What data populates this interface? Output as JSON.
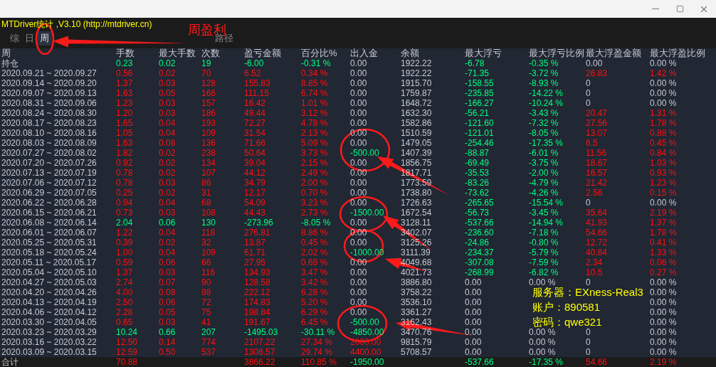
{
  "window": {
    "title": "MTDriver统计 ,V3.10 (http://mtdriver.cn)"
  },
  "tabs": [
    {
      "label": "综",
      "selected": false
    },
    {
      "label": "日",
      "selected": false
    },
    {
      "label": "周",
      "selected": true
    }
  ],
  "path_label": "路径",
  "annotation_label": "周盈利",
  "table": {
    "columns": [
      "周",
      "手数",
      "最大手数",
      "次数",
      "盈亏金额",
      "百分比%",
      "出入金",
      "余额",
      "最大浮亏",
      "最大浮亏比例",
      "最大浮盈金额",
      "最大浮盈比例"
    ],
    "rows": [
      {
        "kind": "open",
        "cells": [
          {
            "text": "持仓"
          },
          {
            "text": "0.23",
            "color": "#00ff80"
          },
          {
            "text": "0.02",
            "color": "#00ff80"
          },
          {
            "text": "19",
            "color": "#00ff80"
          },
          {
            "text": "-6.00",
            "color": "#00ff80"
          },
          {
            "text": "-0.31 %",
            "color": "#00ff80"
          },
          {
            "text": "0.00",
            "color": "#c6cad2"
          },
          {
            "text": "1922.22",
            "color": "#c6cad2"
          },
          {
            "text": "-6.78",
            "color": "#00ff80"
          },
          {
            "text": "-0.35 %",
            "color": "#00ff80"
          },
          {
            "text": "0.00",
            "color": "#c6cad2"
          },
          {
            "text": "0.00 %",
            "color": "#c6cad2"
          }
        ]
      },
      {
        "kind": "week",
        "cells": [
          {
            "text": "2020.09.21 ~ 2020.09.27"
          },
          {
            "text": "0.56",
            "color": "#ff1010"
          },
          {
            "text": "0.02",
            "color": "#ff1010"
          },
          {
            "text": "70",
            "color": "#ff1010"
          },
          {
            "text": "6.52",
            "color": "#ff1010"
          },
          {
            "text": "0.34 %",
            "color": "#ff1010"
          },
          {
            "text": "0.00",
            "color": "#c6cad2"
          },
          {
            "text": "1922.22",
            "color": "#c6cad2"
          },
          {
            "text": "-71.35",
            "color": "#00ff80"
          },
          {
            "text": "-3.72 %",
            "color": "#00ff80"
          },
          {
            "text": "26.83",
            "color": "#ff1010"
          },
          {
            "text": "1.42 %",
            "color": "#ff1010"
          }
        ]
      },
      {
        "kind": "week",
        "cells": [
          {
            "text": "2020.09.14 ~ 2020.09.20"
          },
          {
            "text": "1.37",
            "color": "#ff1010"
          },
          {
            "text": "0.03",
            "color": "#ff1010"
          },
          {
            "text": "128",
            "color": "#ff1010"
          },
          {
            "text": "155.83",
            "color": "#ff1010"
          },
          {
            "text": "8.85 %",
            "color": "#ff1010"
          },
          {
            "text": "0.00",
            "color": "#c6cad2"
          },
          {
            "text": "1915.70",
            "color": "#c6cad2"
          },
          {
            "text": "-158.55",
            "color": "#00ff80"
          },
          {
            "text": "-8.93 %",
            "color": "#00ff80"
          },
          {
            "text": "0",
            "color": "#c6cad2"
          },
          {
            "text": "0.00 %",
            "color": "#c6cad2"
          }
        ]
      },
      {
        "kind": "week",
        "cells": [
          {
            "text": "2020.09.07 ~ 2020.09.13"
          },
          {
            "text": "1.63",
            "color": "#ff1010"
          },
          {
            "text": "0.05",
            "color": "#ff1010"
          },
          {
            "text": "166",
            "color": "#ff1010"
          },
          {
            "text": "111.15",
            "color": "#ff1010"
          },
          {
            "text": "6.74 %",
            "color": "#ff1010"
          },
          {
            "text": "0.00",
            "color": "#c6cad2"
          },
          {
            "text": "1759.87",
            "color": "#c6cad2"
          },
          {
            "text": "-235.85",
            "color": "#00ff80"
          },
          {
            "text": "-14.22 %",
            "color": "#00ff80"
          },
          {
            "text": "0",
            "color": "#c6cad2"
          },
          {
            "text": "0.00 %",
            "color": "#c6cad2"
          }
        ]
      },
      {
        "kind": "week",
        "cells": [
          {
            "text": "2020.08.31 ~ 2020.09.06"
          },
          {
            "text": "1.23",
            "color": "#ff1010"
          },
          {
            "text": "0.03",
            "color": "#ff1010"
          },
          {
            "text": "157",
            "color": "#ff1010"
          },
          {
            "text": "16.42",
            "color": "#ff1010"
          },
          {
            "text": "1.01 %",
            "color": "#ff1010"
          },
          {
            "text": "0.00",
            "color": "#c6cad2"
          },
          {
            "text": "1648.72",
            "color": "#c6cad2"
          },
          {
            "text": "-166.27",
            "color": "#00ff80"
          },
          {
            "text": "-10.24 %",
            "color": "#00ff80"
          },
          {
            "text": "0",
            "color": "#c6cad2"
          },
          {
            "text": "0.00 %",
            "color": "#c6cad2"
          }
        ]
      },
      {
        "kind": "week",
        "cells": [
          {
            "text": "2020.08.24 ~ 2020.08.30"
          },
          {
            "text": "1.20",
            "color": "#ff1010"
          },
          {
            "text": "0.03",
            "color": "#ff1010"
          },
          {
            "text": "186",
            "color": "#ff1010"
          },
          {
            "text": "49.44",
            "color": "#ff1010"
          },
          {
            "text": "3.12 %",
            "color": "#ff1010"
          },
          {
            "text": "0.00",
            "color": "#c6cad2"
          },
          {
            "text": "1632.30",
            "color": "#c6cad2"
          },
          {
            "text": "-56.21",
            "color": "#00ff80"
          },
          {
            "text": "-3.43 %",
            "color": "#00ff80"
          },
          {
            "text": "20.47",
            "color": "#ff1010"
          },
          {
            "text": "1.31 %",
            "color": "#ff1010"
          }
        ]
      },
      {
        "kind": "week",
        "cells": [
          {
            "text": "2020.08.17 ~ 2020.08.23"
          },
          {
            "text": "1.65",
            "color": "#ff1010"
          },
          {
            "text": "0.04",
            "color": "#ff1010"
          },
          {
            "text": "193",
            "color": "#ff1010"
          },
          {
            "text": "72.27",
            "color": "#ff1010"
          },
          {
            "text": "4.78 %",
            "color": "#ff1010"
          },
          {
            "text": "0.00",
            "color": "#c6cad2"
          },
          {
            "text": "1582.86",
            "color": "#c6cad2"
          },
          {
            "text": "-121.60",
            "color": "#00ff80"
          },
          {
            "text": "-7.32 %",
            "color": "#00ff80"
          },
          {
            "text": "27.56",
            "color": "#ff1010"
          },
          {
            "text": "1.78 %",
            "color": "#ff1010"
          }
        ]
      },
      {
        "kind": "week",
        "cells": [
          {
            "text": "2020.08.10 ~ 2020.08.16"
          },
          {
            "text": "1.05",
            "color": "#ff1010"
          },
          {
            "text": "0.04",
            "color": "#ff1010"
          },
          {
            "text": "109",
            "color": "#ff1010"
          },
          {
            "text": "31.54",
            "color": "#ff1010"
          },
          {
            "text": "2.13 %",
            "color": "#ff1010"
          },
          {
            "text": "0.00",
            "color": "#c6cad2"
          },
          {
            "text": "1510.59",
            "color": "#c6cad2"
          },
          {
            "text": "-121.01",
            "color": "#00ff80"
          },
          {
            "text": "-8.05 %",
            "color": "#00ff80"
          },
          {
            "text": "13.07",
            "color": "#ff1010"
          },
          {
            "text": "0.88 %",
            "color": "#ff1010"
          }
        ]
      },
      {
        "kind": "week",
        "cells": [
          {
            "text": "2020.08.03 ~ 2020.08.09"
          },
          {
            "text": "1.63",
            "color": "#ff1010"
          },
          {
            "text": "0.08",
            "color": "#ff1010"
          },
          {
            "text": "136",
            "color": "#ff1010"
          },
          {
            "text": "71.66",
            "color": "#ff1010"
          },
          {
            "text": "5.09 %",
            "color": "#ff1010"
          },
          {
            "text": "0.00",
            "color": "#c6cad2"
          },
          {
            "text": "1479.05",
            "color": "#c6cad2"
          },
          {
            "text": "-254.46",
            "color": "#00ff80"
          },
          {
            "text": "-17.35 %",
            "color": "#00ff80"
          },
          {
            "text": "6.5",
            "color": "#ff1010"
          },
          {
            "text": "0.45 %",
            "color": "#ff1010"
          }
        ]
      },
      {
        "kind": "week",
        "cells": [
          {
            "text": "2020.07.27 ~ 2020.08.02"
          },
          {
            "text": "1.82",
            "color": "#ff1010"
          },
          {
            "text": "0.02",
            "color": "#ff1010"
          },
          {
            "text": "238",
            "color": "#ff1010"
          },
          {
            "text": "50.64",
            "color": "#ff1010"
          },
          {
            "text": "3.73 %",
            "color": "#ff1010"
          },
          {
            "text": "-500.00",
            "color": "#00ff80"
          },
          {
            "text": "1407.39",
            "color": "#c6cad2"
          },
          {
            "text": "-88.87",
            "color": "#00ff80"
          },
          {
            "text": "-6.01 %",
            "color": "#00ff80"
          },
          {
            "text": "11.56",
            "color": "#ff1010"
          },
          {
            "text": "0.84 %",
            "color": "#ff1010"
          }
        ]
      },
      {
        "kind": "week",
        "cells": [
          {
            "text": "2020.07.20 ~ 2020.07.26"
          },
          {
            "text": "0.92",
            "color": "#ff1010"
          },
          {
            "text": "0.02",
            "color": "#ff1010"
          },
          {
            "text": "134",
            "color": "#ff1010"
          },
          {
            "text": "39.04",
            "color": "#ff1010"
          },
          {
            "text": "2.15 %",
            "color": "#ff1010"
          },
          {
            "text": "0.00",
            "color": "#c6cad2"
          },
          {
            "text": "1856.75",
            "color": "#c6cad2"
          },
          {
            "text": "-69.49",
            "color": "#00ff80"
          },
          {
            "text": "-3.75 %",
            "color": "#00ff80"
          },
          {
            "text": "18.67",
            "color": "#ff1010"
          },
          {
            "text": "1.03 %",
            "color": "#ff1010"
          }
        ]
      },
      {
        "kind": "week",
        "cells": [
          {
            "text": "2020.07.13 ~ 2020.07.19"
          },
          {
            "text": "0.78",
            "color": "#ff1010"
          },
          {
            "text": "0.02",
            "color": "#ff1010"
          },
          {
            "text": "107",
            "color": "#ff1010"
          },
          {
            "text": "44.12",
            "color": "#ff1010"
          },
          {
            "text": "2.49 %",
            "color": "#ff1010"
          },
          {
            "text": "0.00",
            "color": "#c6cad2"
          },
          {
            "text": "1817.71",
            "color": "#c6cad2"
          },
          {
            "text": "-35.53",
            "color": "#00ff80"
          },
          {
            "text": "-2.00 %",
            "color": "#00ff80"
          },
          {
            "text": "16.57",
            "color": "#ff1010"
          },
          {
            "text": "0.93 %",
            "color": "#ff1010"
          }
        ]
      },
      {
        "kind": "week",
        "cells": [
          {
            "text": "2020.07.06 ~ 2020.07.12"
          },
          {
            "text": "0.78",
            "color": "#ff1010"
          },
          {
            "text": "0.03",
            "color": "#ff1010"
          },
          {
            "text": "86",
            "color": "#ff1010"
          },
          {
            "text": "34.79",
            "color": "#ff1010"
          },
          {
            "text": "2.00 %",
            "color": "#ff1010"
          },
          {
            "text": "0.00",
            "color": "#c6cad2"
          },
          {
            "text": "1773.59",
            "color": "#c6cad2"
          },
          {
            "text": "-83.26",
            "color": "#00ff80"
          },
          {
            "text": "-4.79 %",
            "color": "#00ff80"
          },
          {
            "text": "21.42",
            "color": "#ff1010"
          },
          {
            "text": "1.23 %",
            "color": "#ff1010"
          }
        ]
      },
      {
        "kind": "week",
        "cells": [
          {
            "text": "2020.06.29 ~ 2020.07.05"
          },
          {
            "text": "0.25",
            "color": "#ff1010"
          },
          {
            "text": "0.02",
            "color": "#ff1010"
          },
          {
            "text": "31",
            "color": "#ff1010"
          },
          {
            "text": "12.17",
            "color": "#ff1010"
          },
          {
            "text": "0.70 %",
            "color": "#ff1010"
          },
          {
            "text": "0.00",
            "color": "#c6cad2"
          },
          {
            "text": "1738.80",
            "color": "#c6cad2"
          },
          {
            "text": "-73.62",
            "color": "#00ff80"
          },
          {
            "text": "-4.26 %",
            "color": "#00ff80"
          },
          {
            "text": "2.56",
            "color": "#ff1010"
          },
          {
            "text": "0.15 %",
            "color": "#ff1010"
          }
        ]
      },
      {
        "kind": "week",
        "cells": [
          {
            "text": "2020.06.22 ~ 2020.06.28"
          },
          {
            "text": "0.94",
            "color": "#ff1010"
          },
          {
            "text": "0.04",
            "color": "#ff1010"
          },
          {
            "text": "68",
            "color": "#ff1010"
          },
          {
            "text": "54.09",
            "color": "#ff1010"
          },
          {
            "text": "3.23 %",
            "color": "#ff1010"
          },
          {
            "text": "0.00",
            "color": "#c6cad2"
          },
          {
            "text": "1726.63",
            "color": "#c6cad2"
          },
          {
            "text": "-265.65",
            "color": "#00ff80"
          },
          {
            "text": "-15.54 %",
            "color": "#00ff80"
          },
          {
            "text": "0",
            "color": "#c6cad2"
          },
          {
            "text": "0.00 %",
            "color": "#c6cad2"
          }
        ]
      },
      {
        "kind": "week",
        "cells": [
          {
            "text": "2020.06.15 ~ 2020.06.21"
          },
          {
            "text": "0.73",
            "color": "#ff1010"
          },
          {
            "text": "0.03",
            "color": "#ff1010"
          },
          {
            "text": "108",
            "color": "#ff1010"
          },
          {
            "text": "44.43",
            "color": "#ff1010"
          },
          {
            "text": "2.73 %",
            "color": "#ff1010"
          },
          {
            "text": "-1500.00",
            "color": "#00ff80"
          },
          {
            "text": "1672.54",
            "color": "#c6cad2"
          },
          {
            "text": "-56.73",
            "color": "#00ff80"
          },
          {
            "text": "-3.45 %",
            "color": "#00ff80"
          },
          {
            "text": "35.64",
            "color": "#ff1010"
          },
          {
            "text": "2.19 %",
            "color": "#ff1010"
          }
        ]
      },
      {
        "kind": "week",
        "cells": [
          {
            "text": "2020.06.08 ~ 2020.06.14"
          },
          {
            "text": "2.04",
            "color": "#00ff80"
          },
          {
            "text": "0.06",
            "color": "#00ff80"
          },
          {
            "text": "130",
            "color": "#00ff80"
          },
          {
            "text": "-273.96",
            "color": "#00ff80"
          },
          {
            "text": "-8.05 %",
            "color": "#00ff80"
          },
          {
            "text": "0.00",
            "color": "#c6cad2"
          },
          {
            "text": "3128.11",
            "color": "#c6cad2"
          },
          {
            "text": "-537.66",
            "color": "#00ff80"
          },
          {
            "text": "-14.94 %",
            "color": "#00ff80"
          },
          {
            "text": "41.93",
            "color": "#ff1010"
          },
          {
            "text": "1.37 %",
            "color": "#ff1010"
          }
        ]
      },
      {
        "kind": "week",
        "cells": [
          {
            "text": "2020.06.01 ~ 2020.06.07"
          },
          {
            "text": "1.22",
            "color": "#ff1010"
          },
          {
            "text": "0.04",
            "color": "#ff1010"
          },
          {
            "text": "118",
            "color": "#ff1010"
          },
          {
            "text": "276.81",
            "color": "#ff1010"
          },
          {
            "text": "8.86 %",
            "color": "#ff1010"
          },
          {
            "text": "0.00",
            "color": "#c6cad2"
          },
          {
            "text": "3402.07",
            "color": "#c6cad2"
          },
          {
            "text": "-236.60",
            "color": "#00ff80"
          },
          {
            "text": "-7.18 %",
            "color": "#00ff80"
          },
          {
            "text": "54.66",
            "color": "#ff1010"
          },
          {
            "text": "1.78 %",
            "color": "#ff1010"
          }
        ]
      },
      {
        "kind": "week",
        "cells": [
          {
            "text": "2020.05.25 ~ 2020.05.31"
          },
          {
            "text": "0.39",
            "color": "#ff1010"
          },
          {
            "text": "0.02",
            "color": "#ff1010"
          },
          {
            "text": "32",
            "color": "#ff1010"
          },
          {
            "text": "13.87",
            "color": "#ff1010"
          },
          {
            "text": "0.45 %",
            "color": "#ff1010"
          },
          {
            "text": "0.00",
            "color": "#c6cad2"
          },
          {
            "text": "3125.26",
            "color": "#c6cad2"
          },
          {
            "text": "-24.86",
            "color": "#00ff80"
          },
          {
            "text": "-0.80 %",
            "color": "#00ff80"
          },
          {
            "text": "12.72",
            "color": "#ff1010"
          },
          {
            "text": "0.41 %",
            "color": "#ff1010"
          }
        ]
      },
      {
        "kind": "week",
        "cells": [
          {
            "text": "2020.05.18 ~ 2020.05.24"
          },
          {
            "text": "1.00",
            "color": "#ff1010"
          },
          {
            "text": "0.04",
            "color": "#ff1010"
          },
          {
            "text": "109",
            "color": "#ff1010"
          },
          {
            "text": "61.71",
            "color": "#ff1010"
          },
          {
            "text": "2.02 %",
            "color": "#ff1010"
          },
          {
            "text": "-1000.00",
            "color": "#00ff80"
          },
          {
            "text": "3111.39",
            "color": "#c6cad2"
          },
          {
            "text": "-234.37",
            "color": "#00ff80"
          },
          {
            "text": "-5.79 %",
            "color": "#00ff80"
          },
          {
            "text": "40.84",
            "color": "#ff1010"
          },
          {
            "text": "1.33 %",
            "color": "#ff1010"
          }
        ]
      },
      {
        "kind": "week",
        "cells": [
          {
            "text": "2020.05.11 ~ 2020.05.17"
          },
          {
            "text": "0.59",
            "color": "#ff1010"
          },
          {
            "text": "0.06",
            "color": "#ff1010"
          },
          {
            "text": "66",
            "color": "#ff1010"
          },
          {
            "text": "27.95",
            "color": "#ff1010"
          },
          {
            "text": "0.69 %",
            "color": "#ff1010"
          },
          {
            "text": "0.00",
            "color": "#c6cad2"
          },
          {
            "text": "4049.68",
            "color": "#c6cad2"
          },
          {
            "text": "-307.08",
            "color": "#00ff80"
          },
          {
            "text": "-7.59 %",
            "color": "#00ff80"
          },
          {
            "text": "2.34",
            "color": "#ff1010"
          },
          {
            "text": "0.06 %",
            "color": "#ff1010"
          }
        ]
      },
      {
        "kind": "week",
        "cells": [
          {
            "text": "2020.05.04 ~ 2020.05.10"
          },
          {
            "text": "1.37",
            "color": "#ff1010"
          },
          {
            "text": "0.03",
            "color": "#ff1010"
          },
          {
            "text": "116",
            "color": "#ff1010"
          },
          {
            "text": "134.93",
            "color": "#ff1010"
          },
          {
            "text": "3.47 %",
            "color": "#ff1010"
          },
          {
            "text": "0.00",
            "color": "#c6cad2"
          },
          {
            "text": "4021.73",
            "color": "#c6cad2"
          },
          {
            "text": "-268.99",
            "color": "#00ff80"
          },
          {
            "text": "-6.82 %",
            "color": "#00ff80"
          },
          {
            "text": "10.5",
            "color": "#ff1010"
          },
          {
            "text": "0.27 %",
            "color": "#ff1010"
          }
        ]
      },
      {
        "kind": "week",
        "cells": [
          {
            "text": "2020.04.27 ~ 2020.05.03"
          },
          {
            "text": "2.74",
            "color": "#ff1010"
          },
          {
            "text": "0.07",
            "color": "#ff1010"
          },
          {
            "text": "90",
            "color": "#ff1010"
          },
          {
            "text": "128.58",
            "color": "#ff1010"
          },
          {
            "text": "3.42 %",
            "color": "#ff1010"
          },
          {
            "text": "0.00",
            "color": "#c6cad2"
          },
          {
            "text": "3886.80",
            "color": "#c6cad2"
          },
          {
            "text": "0.00",
            "color": "#c6cad2"
          },
          {
            "text": "0.00 %",
            "color": "#c6cad2"
          },
          {
            "text": "0",
            "color": "#c6cad2"
          },
          {
            "text": "0.00 %",
            "color": "#c6cad2"
          }
        ]
      },
      {
        "kind": "week",
        "cells": [
          {
            "text": "2020.04.20 ~ 2020.04.26"
          },
          {
            "text": "4.00",
            "color": "#ff1010"
          },
          {
            "text": "0.08",
            "color": "#ff1010"
          },
          {
            "text": "98",
            "color": "#ff1010"
          },
          {
            "text": "222.12",
            "color": "#ff1010"
          },
          {
            "text": "6.28 %",
            "color": "#ff1010"
          },
          {
            "text": "0.00",
            "color": "#c6cad2"
          },
          {
            "text": "3758.22",
            "color": "#c6cad2"
          },
          {
            "text": "0.00",
            "color": "#c6cad2"
          },
          null,
          null,
          {
            "text": "0.00 %",
            "color": "#c6cad2"
          }
        ]
      },
      {
        "kind": "week",
        "cells": [
          {
            "text": "2020.04.13 ~ 2020.04.19"
          },
          {
            "text": "2.50",
            "color": "#ff1010"
          },
          {
            "text": "0.06",
            "color": "#ff1010"
          },
          {
            "text": "72",
            "color": "#ff1010"
          },
          {
            "text": "174.83",
            "color": "#ff1010"
          },
          {
            "text": "5.20 %",
            "color": "#ff1010"
          },
          {
            "text": "0.00",
            "color": "#c6cad2"
          },
          {
            "text": "3536.10",
            "color": "#c6cad2"
          },
          {
            "text": "0.00",
            "color": "#c6cad2"
          },
          null,
          null,
          {
            "text": "0.00 %",
            "color": "#c6cad2"
          }
        ]
      },
      {
        "kind": "week",
        "cells": [
          {
            "text": "2020.04.06 ~ 2020.04.12"
          },
          {
            "text": "2.28",
            "color": "#ff1010"
          },
          {
            "text": "0.05",
            "color": "#ff1010"
          },
          {
            "text": "75",
            "color": "#ff1010"
          },
          {
            "text": "198.84",
            "color": "#ff1010"
          },
          {
            "text": "6.29 %",
            "color": "#ff1010"
          },
          {
            "text": "0.00",
            "color": "#c6cad2"
          },
          {
            "text": "3361.27",
            "color": "#c6cad2"
          },
          {
            "text": "0.00",
            "color": "#c6cad2"
          },
          null,
          null,
          {
            "text": "0.00 %",
            "color": "#c6cad2"
          }
        ]
      },
      {
        "kind": "week",
        "cells": [
          {
            "text": "2020.03.30 ~ 2020.04.05"
          },
          {
            "text": "0.65",
            "color": "#ff1010"
          },
          {
            "text": "0.03",
            "color": "#ff1010"
          },
          {
            "text": "41",
            "color": "#ff1010"
          },
          {
            "text": "191.67",
            "color": "#ff1010"
          },
          {
            "text": "6.45 %",
            "color": "#ff1010"
          },
          {
            "text": "-500.00",
            "color": "#00ff80"
          },
          {
            "text": "3162.43",
            "color": "#c6cad2"
          },
          {
            "text": "0.00",
            "color": "#c6cad2"
          },
          null,
          null,
          {
            "text": "0.00 %",
            "color": "#c6cad2"
          }
        ]
      },
      {
        "kind": "week",
        "cells": [
          {
            "text": "2020.03.23 ~ 2020.03.29"
          },
          {
            "text": "10.24",
            "color": "#00ff80"
          },
          {
            "text": "0.66",
            "color": "#00ff80"
          },
          {
            "text": "207",
            "color": "#00ff80"
          },
          {
            "text": "-1495.03",
            "color": "#00ff80"
          },
          {
            "text": "-30.11 %",
            "color": "#00ff80"
          },
          {
            "text": "-4850.00",
            "color": "#00ff80"
          },
          {
            "text": "3470.76",
            "color": "#c6cad2"
          },
          {
            "text": "0.00",
            "color": "#c6cad2"
          },
          {
            "text": "0.00 %",
            "color": "#c6cad2"
          },
          {
            "text": "0",
            "color": "#c6cad2"
          },
          {
            "text": "0.00 %",
            "color": "#c6cad2"
          }
        ]
      },
      {
        "kind": "week",
        "cells": [
          {
            "text": "2020.03.16 ~ 2020.03.22"
          },
          {
            "text": "12.50",
            "color": "#ff1010"
          },
          {
            "text": "0.14",
            "color": "#ff1010"
          },
          {
            "text": "774",
            "color": "#ff1010"
          },
          {
            "text": "2107.22",
            "color": "#ff1010"
          },
          {
            "text": "27.34 %",
            "color": "#ff1010"
          },
          {
            "text": "2000.00",
            "color": "#ff1010"
          },
          {
            "text": "9815.79",
            "color": "#c6cad2"
          },
          {
            "text": "0.00",
            "color": "#c6cad2"
          },
          {
            "text": "0.00 %",
            "color": "#c6cad2"
          },
          {
            "text": "0",
            "color": "#c6cad2"
          },
          {
            "text": "0.00 %",
            "color": "#c6cad2"
          }
        ]
      },
      {
        "kind": "week",
        "cells": [
          {
            "text": "2020.03.09 ~ 2020.03.15"
          },
          {
            "text": "12.59",
            "color": "#ff1010"
          },
          {
            "text": "0.50",
            "color": "#ff1010"
          },
          {
            "text": "537",
            "color": "#ff1010"
          },
          {
            "text": "1308.57",
            "color": "#ff1010"
          },
          {
            "text": "29.74 %",
            "color": "#ff1010"
          },
          {
            "text": "4400.00",
            "color": "#ff1010"
          },
          {
            "text": "5708.57",
            "color": "#c6cad2"
          },
          {
            "text": "0.00",
            "color": "#c6cad2"
          },
          {
            "text": "0.00 %",
            "color": "#c6cad2"
          },
          {
            "text": "0",
            "color": "#c6cad2"
          },
          {
            "text": "0.00 %",
            "color": "#c6cad2"
          }
        ]
      },
      {
        "kind": "total",
        "cells": [
          {
            "text": "合计"
          },
          {
            "text": "70.88",
            "color": "#ff1010"
          },
          null,
          null,
          {
            "text": "3866.22",
            "color": "#ff1010"
          },
          {
            "text": "110.85 %",
            "color": "#ff1010"
          },
          {
            "text": "-1950.00",
            "color": "#00ff80"
          },
          null,
          {
            "text": "-537.66",
            "color": "#00ff80"
          },
          {
            "text": "-17.35 %",
            "color": "#00ff80"
          },
          {
            "text": "54.66",
            "color": "#ff1010"
          },
          {
            "text": "2.19 %",
            "color": "#ff1010"
          }
        ]
      }
    ]
  },
  "overlay_note": [
    "服务器：EXness-Real3",
    "账户：890581",
    "密码：qwe321"
  ]
}
